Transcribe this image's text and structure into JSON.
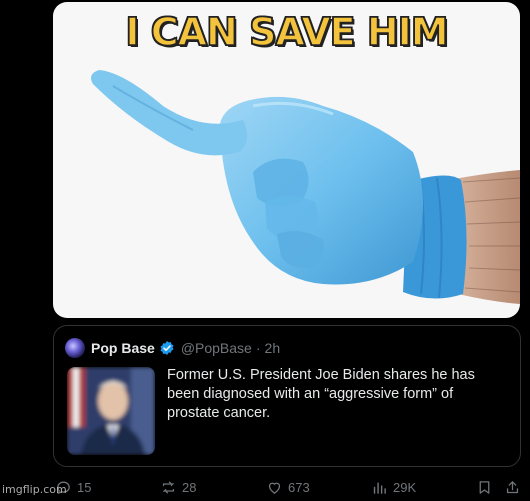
{
  "meme": {
    "caption": "I CAN SAVE HIM"
  },
  "quote": {
    "name": "Pop Base",
    "handle": "@PopBase",
    "separator": "·",
    "time": "2h",
    "text": "Former U.S. President Joe Biden shares he has been diagnosed with an “aggressive form” of prostate cancer."
  },
  "actions": {
    "replies": "15",
    "reposts": "28",
    "likes": "673",
    "views": "29K"
  },
  "watermark": "imgflip.com",
  "icons": [
    "verified-badge-icon",
    "reply-icon",
    "repost-icon",
    "like-icon",
    "views-icon",
    "bookmark-icon",
    "share-icon"
  ],
  "colors": {
    "background": "#000000",
    "caption": "#f4c33d",
    "verified": "#1d9bf0",
    "muted": "#71767b",
    "text": "#e7e9ea"
  }
}
